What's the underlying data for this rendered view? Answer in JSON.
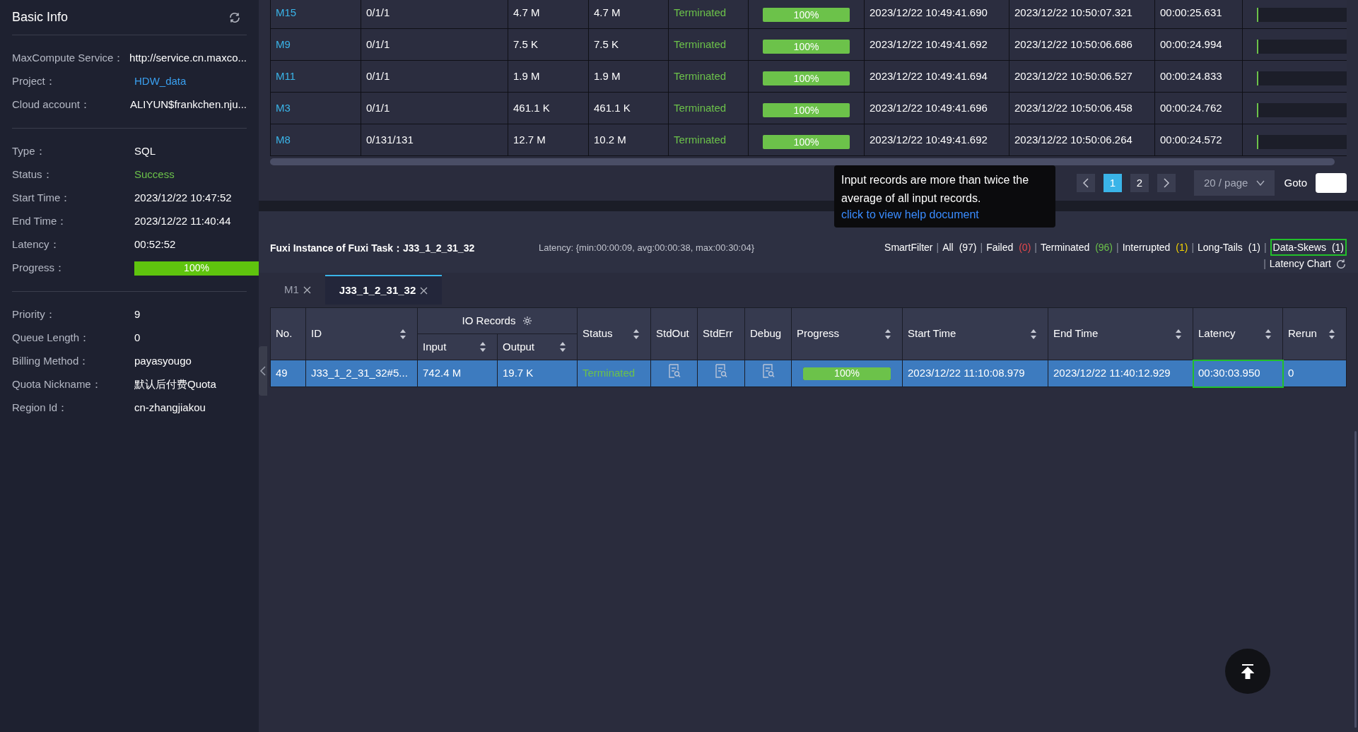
{
  "sidebar": {
    "title": "Basic Info",
    "groups": [
      [
        {
          "label": "MaxCompute Service：",
          "value": "http://service.cn.maxco..."
        },
        {
          "label": "Project：",
          "value": "HDW_data",
          "kind": "link"
        },
        {
          "label": "Cloud account：",
          "value": "ALIYUN$frankchen.nju..."
        }
      ],
      [
        {
          "label": "Type：",
          "value": "SQL"
        },
        {
          "label": "Status：",
          "value": "Success",
          "kind": "status"
        },
        {
          "label": "Start Time：",
          "value": "2023/12/22 10:47:52"
        },
        {
          "label": "End Time：",
          "value": "2023/12/22 11:40:44"
        },
        {
          "label": "Latency：",
          "value": "00:52:52"
        },
        {
          "label": "Progress：",
          "value": "100%",
          "kind": "progress",
          "level": 1
        }
      ],
      [
        {
          "label": "Priority：",
          "value": "9"
        },
        {
          "label": "Queue Length：",
          "value": "0"
        },
        {
          "label": "Billing Method：",
          "value": "payasyougo"
        },
        {
          "label": "Quota Nickname：",
          "value": "默认后付费Quota"
        },
        {
          "label": "Region Id：",
          "value": "cn-zhangjiakou"
        }
      ]
    ]
  },
  "task_table": {
    "rows": [
      {
        "id": "M15",
        "instances": "0/1/1",
        "input": "4.7 M",
        "output": "4.7 M",
        "status": "Terminated",
        "progress": "100%",
        "level": 1,
        "start": "2023/12/22 10:49:41.690",
        "end": "2023/12/22 10:50:07.321",
        "latency": "00:00:25.631"
      },
      {
        "id": "M9",
        "instances": "0/1/1",
        "input": "7.5 K",
        "output": "7.5 K",
        "status": "Terminated",
        "progress": "100%",
        "level": 1,
        "start": "2023/12/22 10:49:41.692",
        "end": "2023/12/22 10:50:06.686",
        "latency": "00:00:24.994"
      },
      {
        "id": "M11",
        "instances": "0/1/1",
        "input": "1.9 M",
        "output": "1.9 M",
        "status": "Terminated",
        "progress": "100%",
        "level": 1,
        "start": "2023/12/22 10:49:41.694",
        "end": "2023/12/22 10:50:06.527",
        "latency": "00:00:24.833"
      },
      {
        "id": "M3",
        "instances": "0/1/1",
        "input": "461.1 K",
        "output": "461.1 K",
        "status": "Terminated",
        "progress": "100%",
        "level": 1,
        "start": "2023/12/22 10:49:41.696",
        "end": "2023/12/22 10:50:06.458",
        "latency": "00:00:24.762"
      },
      {
        "id": "M8",
        "instances": "0/131/131",
        "input": "12.7 M",
        "output": "10.2 M",
        "status": "Terminated",
        "progress": "100%",
        "level": 1,
        "start": "2023/12/22 10:49:41.692",
        "end": "2023/12/22 10:50:06.264",
        "latency": "00:00:24.572"
      }
    ]
  },
  "pagination": {
    "pages": [
      {
        "label": "1",
        "selected": true
      },
      {
        "label": "2",
        "selected": false
      }
    ],
    "page_size": "20 / page",
    "goto": "Goto"
  },
  "fuxi": {
    "title": "Fuxi Instance of Fuxi Task：J33_1_2_31_32",
    "latency": "Latency: {min:00:00:09, avg:00:00:38, max:00:30:04}",
    "filters": [
      {
        "kind": "title",
        "label": "SmartFilter"
      },
      {
        "kind": "separator",
        "label": "|"
      },
      {
        "kind": "filter",
        "label": "All",
        "count": "(97)",
        "color": "#ffffff",
        "highlighted": false
      },
      {
        "kind": "separator",
        "label": "|"
      },
      {
        "kind": "filter",
        "label": "Failed",
        "count": "(0)",
        "color": "#e5484d",
        "highlighted": false
      },
      {
        "kind": "separator",
        "label": "|"
      },
      {
        "kind": "filter",
        "label": "Terminated",
        "count": "(96)",
        "color": "#6cc24a",
        "highlighted": false
      },
      {
        "kind": "separator",
        "label": "|"
      },
      {
        "kind": "filter",
        "label": "Interrupted",
        "count": "(1)",
        "color": "#f5d300",
        "highlighted": false
      },
      {
        "kind": "separator",
        "label": "|"
      },
      {
        "kind": "filter",
        "label": "Long-Tails",
        "count": "(1)",
        "color": "#ffffff",
        "highlighted": false
      },
      {
        "kind": "separator",
        "label": "|"
      },
      {
        "kind": "filter",
        "label": "Data-Skews",
        "count": "(1)",
        "color": "#ffffff",
        "highlighted": true
      },
      {
        "kind": "separator",
        "label": "|"
      },
      {
        "kind": "chart",
        "label": "Latency Chart"
      }
    ],
    "tooltip": {
      "text": "Input records are more than twice the average of all input records.",
      "link": "click to view help document"
    },
    "tabs": [
      {
        "label": "M1",
        "selected": false
      },
      {
        "label": "J33_1_2_31_32",
        "selected": true
      }
    ]
  },
  "instance_table": {
    "columns": [
      "No.",
      "ID",
      "IO Records",
      "Input",
      "Output",
      "Status",
      "StdOut",
      "StdErr",
      "Debug",
      "Progress",
      "Start Time",
      "End Time",
      "Latency",
      "Rerun"
    ],
    "rows": [
      {
        "no": "49",
        "id": "J33_1_2_31_32#5...",
        "input": "742.4 M",
        "output": "19.7 K",
        "status": "Terminated",
        "progress": "100%",
        "level": 1,
        "start": "2023/12/22 11:10:08.979",
        "end": "2023/12/22 11:40:12.929",
        "latency": "00:30:03.950",
        "latency_highlighted": true,
        "rerun": "0",
        "selected": true
      }
    ]
  }
}
